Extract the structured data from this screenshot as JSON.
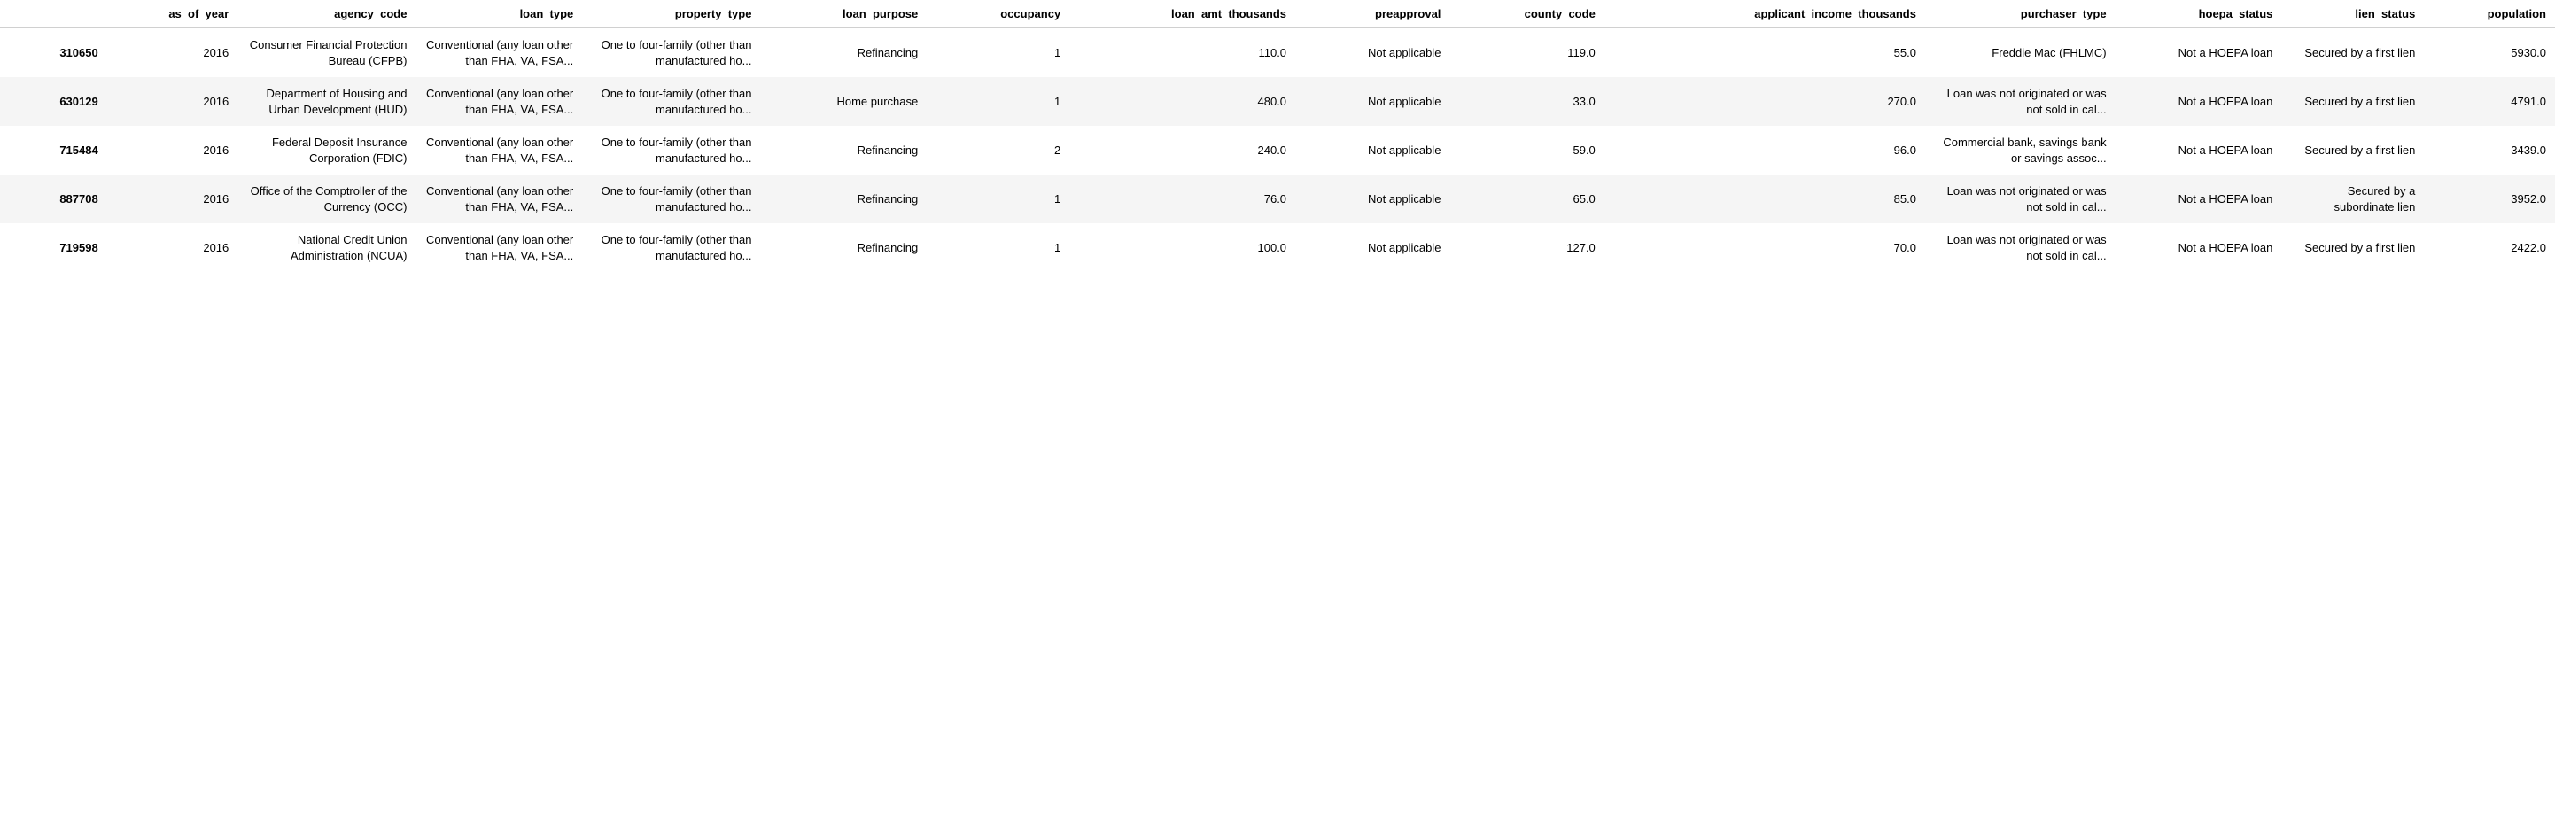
{
  "columns": [
    "",
    "as_of_year",
    "agency_code",
    "loan_type",
    "property_type",
    "loan_purpose",
    "occupancy",
    "loan_amt_thousands",
    "preapproval",
    "county_code",
    "applicant_income_thousands",
    "purchaser_type",
    "hoepa_status",
    "lien_status",
    "population"
  ],
  "rows": [
    {
      "index": "310650",
      "as_of_year": "2016",
      "agency_code": "Consumer Financial Protection Bureau (CFPB)",
      "loan_type": "Conventional (any loan other than FHA, VA, FSA...",
      "property_type": "One to four-family (other than manufactured ho...",
      "loan_purpose": "Refinancing",
      "occupancy": "1",
      "loan_amt_thousands": "110.0",
      "preapproval": "Not applicable",
      "county_code": "119.0",
      "applicant_income_thousands": "55.0",
      "purchaser_type": "Freddie Mac (FHLMC)",
      "hoepa_status": "Not a HOEPA loan",
      "lien_status": "Secured by a first lien",
      "population": "5930.0"
    },
    {
      "index": "630129",
      "as_of_year": "2016",
      "agency_code": "Department of Housing and Urban Development (HUD)",
      "loan_type": "Conventional (any loan other than FHA, VA, FSA...",
      "property_type": "One to four-family (other than manufactured ho...",
      "loan_purpose": "Home purchase",
      "occupancy": "1",
      "loan_amt_thousands": "480.0",
      "preapproval": "Not applicable",
      "county_code": "33.0",
      "applicant_income_thousands": "270.0",
      "purchaser_type": "Loan was not originated or was not sold in cal...",
      "hoepa_status": "Not a HOEPA loan",
      "lien_status": "Secured by a first lien",
      "population": "4791.0"
    },
    {
      "index": "715484",
      "as_of_year": "2016",
      "agency_code": "Federal Deposit Insurance Corporation (FDIC)",
      "loan_type": "Conventional (any loan other than FHA, VA, FSA...",
      "property_type": "One to four-family (other than manufactured ho...",
      "loan_purpose": "Refinancing",
      "occupancy": "2",
      "loan_amt_thousands": "240.0",
      "preapproval": "Not applicable",
      "county_code": "59.0",
      "applicant_income_thousands": "96.0",
      "purchaser_type": "Commercial bank, savings bank or savings assoc...",
      "hoepa_status": "Not a HOEPA loan",
      "lien_status": "Secured by a first lien",
      "population": "3439.0"
    },
    {
      "index": "887708",
      "as_of_year": "2016",
      "agency_code": "Office of the Comptroller of the Currency (OCC)",
      "loan_type": "Conventional (any loan other than FHA, VA, FSA...",
      "property_type": "One to four-family (other than manufactured ho...",
      "loan_purpose": "Refinancing",
      "occupancy": "1",
      "loan_amt_thousands": "76.0",
      "preapproval": "Not applicable",
      "county_code": "65.0",
      "applicant_income_thousands": "85.0",
      "purchaser_type": "Loan was not originated or was not sold in cal...",
      "hoepa_status": "Not a HOEPA loan",
      "lien_status": "Secured by a subordinate lien",
      "population": "3952.0"
    },
    {
      "index": "719598",
      "as_of_year": "2016",
      "agency_code": "National Credit Union Administration (NCUA)",
      "loan_type": "Conventional (any loan other than FHA, VA, FSA...",
      "property_type": "One to four-family (other than manufactured ho...",
      "loan_purpose": "Refinancing",
      "occupancy": "1",
      "loan_amt_thousands": "100.0",
      "preapproval": "Not applicable",
      "county_code": "127.0",
      "applicant_income_thousands": "70.0",
      "purchaser_type": "Loan was not originated or was not sold in cal...",
      "hoepa_status": "Not a HOEPA loan",
      "lien_status": "Secured by a first lien",
      "population": "2422.0"
    }
  ]
}
